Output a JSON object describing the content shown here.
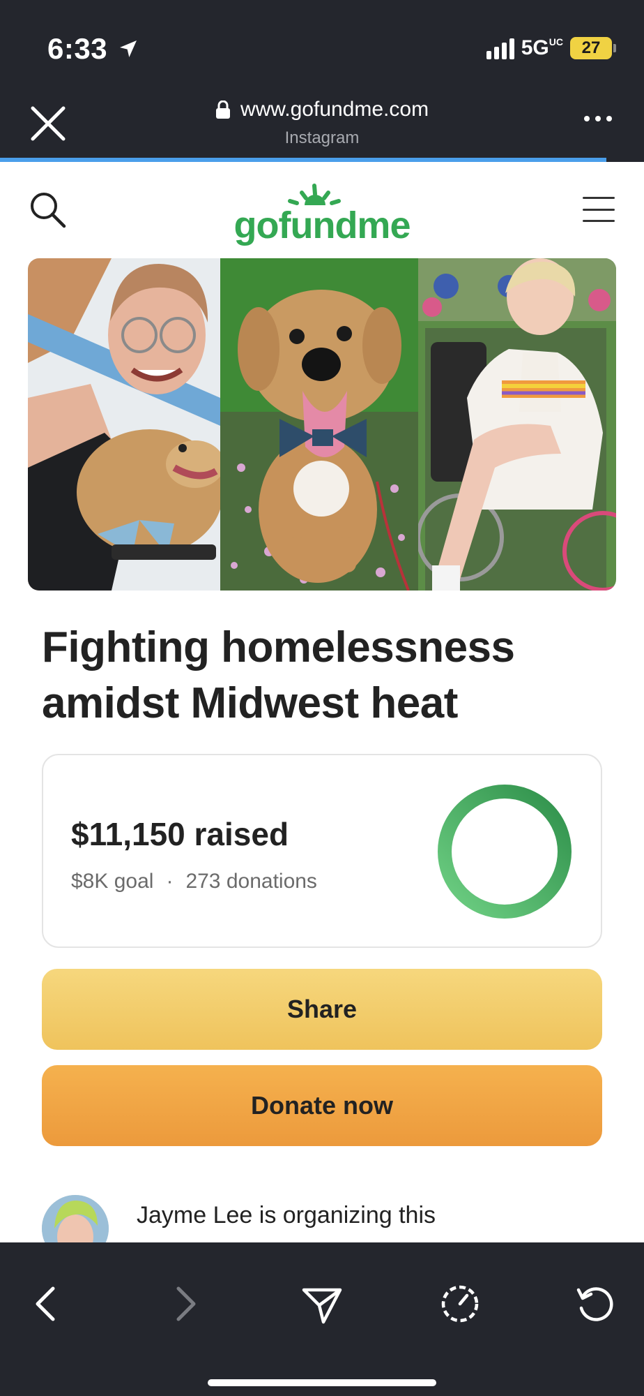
{
  "status_bar": {
    "time": "6:33",
    "network": "5G",
    "network_sup": "UC",
    "battery": "27"
  },
  "browser": {
    "url": "www.gofundme.com",
    "source": "Instagram"
  },
  "site": {
    "logo_text": "gofundme",
    "brand_color": "#34a853"
  },
  "campaign": {
    "title": "Fighting homelessness amidst Midwest heat",
    "raised": "$11,150 raised",
    "goal": "$8K goal",
    "separator": "·",
    "donations": "273 donations",
    "progress_fraction": 1.0
  },
  "actions": {
    "share_label": "Share",
    "donate_label": "Donate now"
  },
  "organizer": {
    "text": "Jayme Lee is organizing this"
  }
}
